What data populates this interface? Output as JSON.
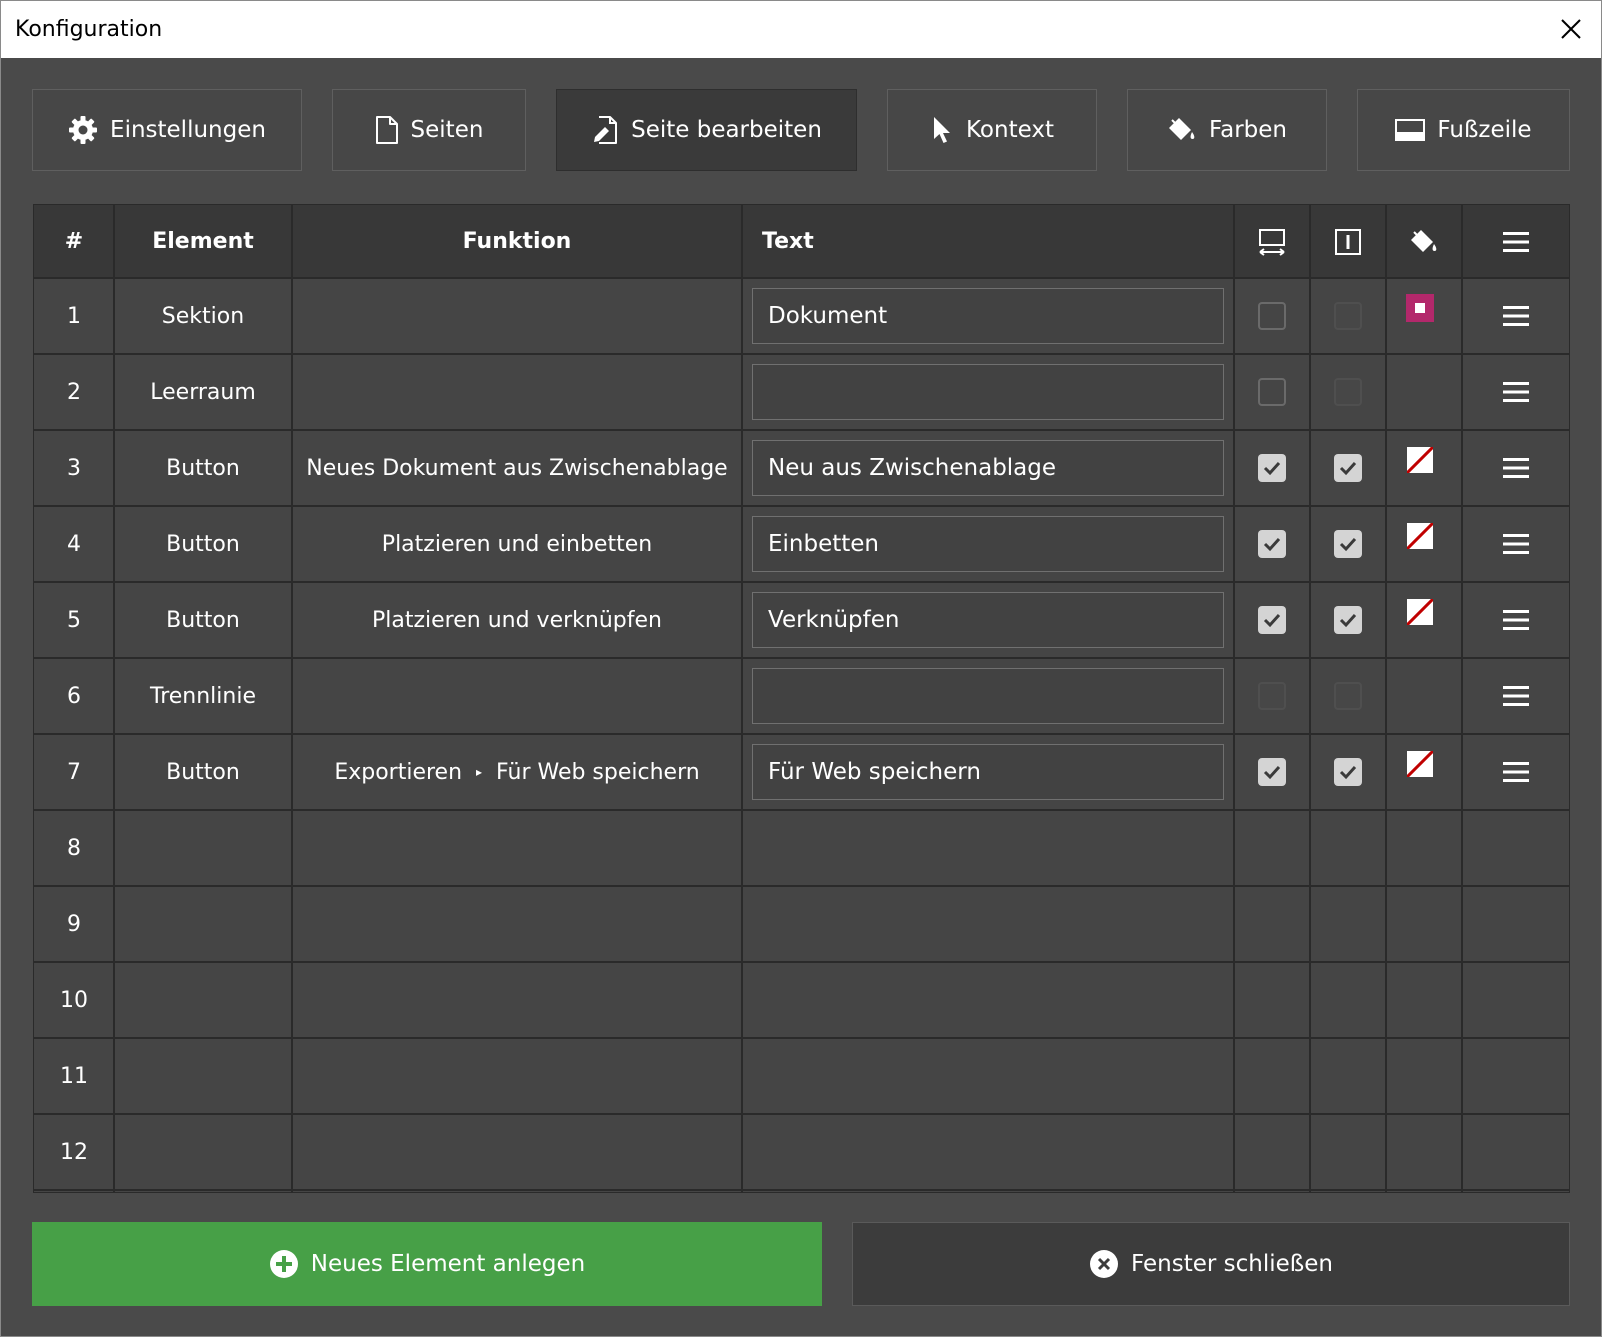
{
  "window": {
    "title": "Konfiguration"
  },
  "tabs": [
    {
      "label": "Einstellungen",
      "icon": "gear-icon",
      "active": false
    },
    {
      "label": "Seiten",
      "icon": "page-icon",
      "active": false
    },
    {
      "label": "Seite bearbeiten",
      "icon": "edit-page-icon",
      "active": true
    },
    {
      "label": "Kontext",
      "icon": "cursor-icon",
      "active": false
    },
    {
      "label": "Farben",
      "icon": "paint-bucket-icon",
      "active": false
    },
    {
      "label": "Fußzeile",
      "icon": "footer-icon",
      "active": false
    }
  ],
  "table": {
    "headers": {
      "num": "#",
      "element": "Element",
      "funktion": "Funktion",
      "text": "Text",
      "icon_cols": [
        "width-icon",
        "text-cursor-icon",
        "paint-bucket-icon",
        "menu-icon"
      ]
    },
    "rows": [
      {
        "num": "1",
        "element": "Sektion",
        "funktion": "",
        "text": "Dokument",
        "c1": "off",
        "c2": "dis",
        "color": "magenta",
        "menu": true
      },
      {
        "num": "2",
        "element": "Leerraum",
        "funktion": "",
        "text": "",
        "c1": "off",
        "c2": "dis",
        "color": "",
        "menu": true
      },
      {
        "num": "3",
        "element": "Button",
        "funktion": "Neues Dokument aus Zwischenablage",
        "text": "Neu aus Zwischenablage",
        "c1": "on",
        "c2": "on",
        "color": "none",
        "menu": true
      },
      {
        "num": "4",
        "element": "Button",
        "funktion": "Platzieren und einbetten",
        "text": "Einbetten",
        "c1": "on",
        "c2": "on",
        "color": "none",
        "menu": true
      },
      {
        "num": "5",
        "element": "Button",
        "funktion": "Platzieren und verknüpfen",
        "text": "Verknüpfen",
        "c1": "on",
        "c2": "on",
        "color": "none",
        "menu": true
      },
      {
        "num": "6",
        "element": "Trennlinie",
        "funktion": "",
        "text": "",
        "c1": "dis",
        "c2": "dis",
        "color": "",
        "menu": true
      },
      {
        "num": "7",
        "element": "Button",
        "funktion_parts": [
          "Exportieren",
          "Für Web speichern"
        ],
        "text": "Für Web speichern",
        "c1": "on",
        "c2": "on",
        "color": "none",
        "menu": true
      },
      {
        "num": "8"
      },
      {
        "num": "9"
      },
      {
        "num": "10"
      },
      {
        "num": "11"
      },
      {
        "num": "12"
      }
    ]
  },
  "buttons": {
    "new_element": "Neues Element anlegen",
    "close_window": "Fenster schließen"
  },
  "colors": {
    "background": "#4a4a4a",
    "green_button": "#47a047",
    "magenta_swatch": "#b3286b"
  }
}
